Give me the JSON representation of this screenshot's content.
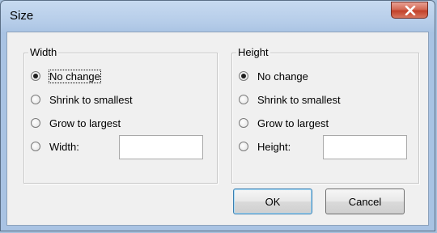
{
  "window": {
    "title": "Size"
  },
  "width_group": {
    "label": "Width",
    "options": [
      "No change",
      "Shrink to smallest",
      "Grow to largest",
      "Width:"
    ],
    "selected": "No change",
    "width_value": ""
  },
  "height_group": {
    "label": "Height",
    "options": [
      "No change",
      "Shrink to smallest",
      "Grow to largest",
      "Height:"
    ],
    "selected": "No change",
    "height_value": ""
  },
  "buttons": {
    "ok": "OK",
    "cancel": "Cancel"
  },
  "icons": {
    "close": "close-icon"
  }
}
